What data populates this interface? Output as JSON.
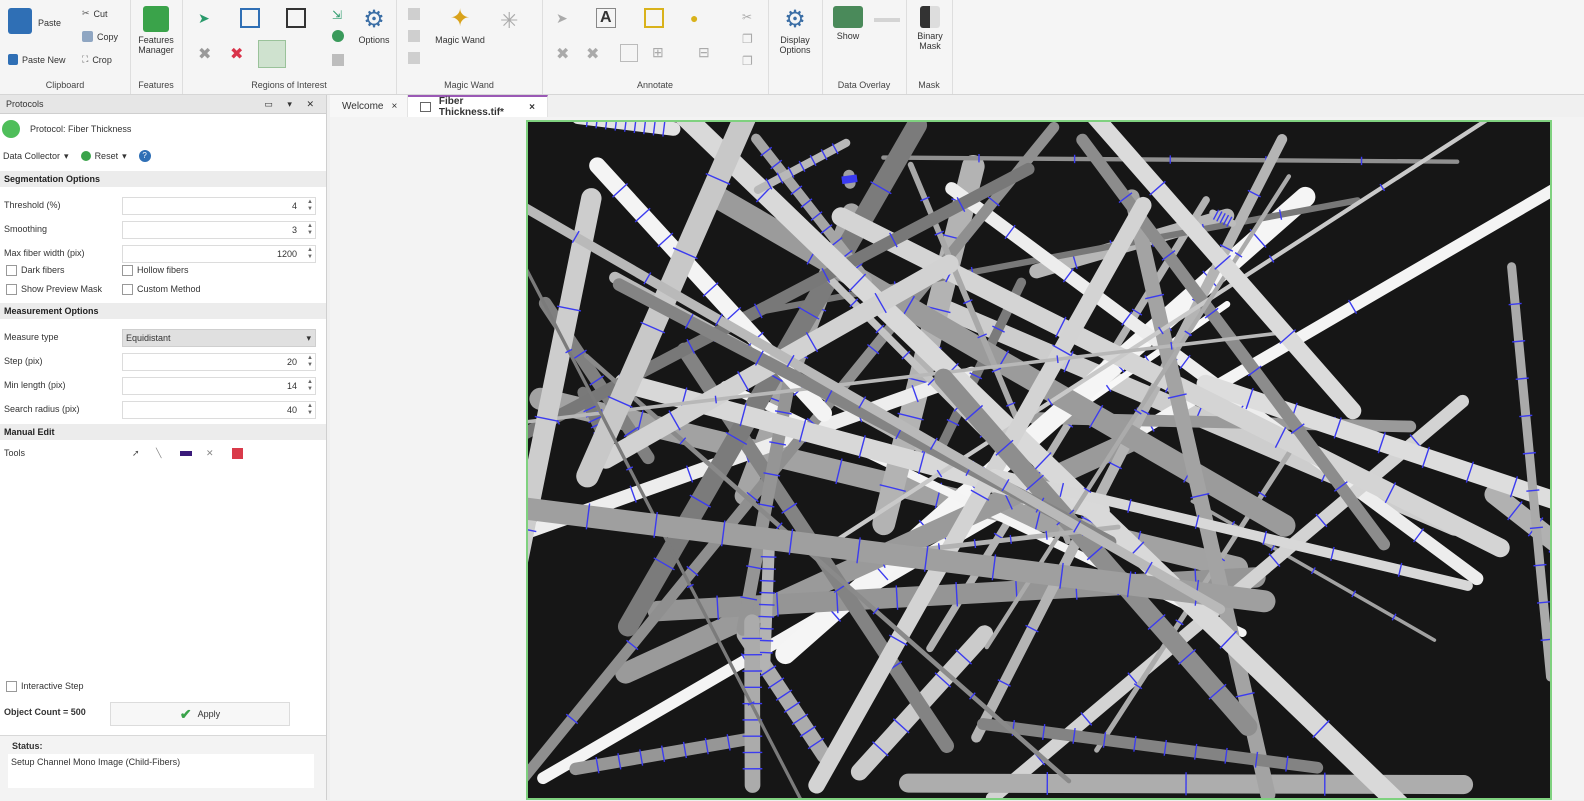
{
  "ribbon": {
    "clipboard": {
      "paste": "Paste",
      "paste_new": "Paste New",
      "cut": "Cut",
      "copy": "Copy",
      "crop": "Crop",
      "label": "Clipboard"
    },
    "features": {
      "manager": "Features\nManager",
      "label": "Features"
    },
    "regions": {
      "options": "Options",
      "label": "Regions of Interest"
    },
    "magic_wand": {
      "wand": "Magic Wand",
      "label": "Magic Wand"
    },
    "annotate": {
      "label": "Annotate"
    },
    "display": {
      "options": "Display\nOptions"
    },
    "data_overlay": {
      "show": "Show",
      "label": "Data Overlay"
    },
    "mask": {
      "binary": "Binary\nMask",
      "label": "Mask"
    }
  },
  "panel": {
    "title": "Protocols",
    "protocol_name": "Protocol: Fiber Thickness",
    "data_collector": "Data Collector",
    "reset": "Reset",
    "segmentation": {
      "heading": "Segmentation Options",
      "threshold_label": "Threshold (%)",
      "threshold_value": "4",
      "smoothing_label": "Smoothing",
      "smoothing_value": "3",
      "maxwidth_label": "Max fiber width (pix)",
      "maxwidth_value": "1200",
      "dark": "Dark fibers",
      "hollow": "Hollow fibers",
      "preview": "Show Preview Mask",
      "custom": "Custom Method"
    },
    "measurement": {
      "heading": "Measurement Options",
      "type_label": "Measure type",
      "type_value": "Equidistant",
      "step_label": "Step (pix)",
      "step_value": "20",
      "minlen_label": "Min length (pix)",
      "minlen_value": "14",
      "radius_label": "Search radius (pix)",
      "radius_value": "40"
    },
    "manual": {
      "heading": "Manual Edit",
      "tools": "Tools"
    },
    "interactive_step": "Interactive Step",
    "object_count": "Object Count = 500",
    "apply": "Apply",
    "status_label": "Status:",
    "status_text": "Setup Channel Mono Image (Child-Fibers)"
  },
  "tabs": [
    {
      "label": "Welcome"
    },
    {
      "label": "Fiber Thickness.tif*"
    }
  ]
}
